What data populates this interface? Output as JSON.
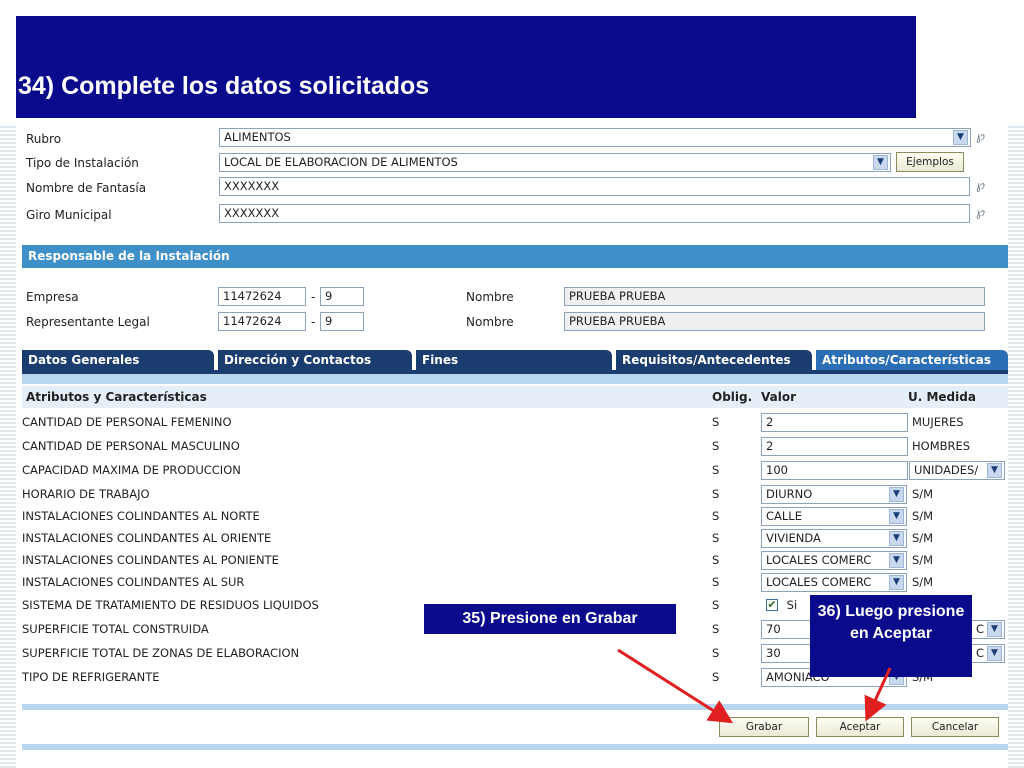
{
  "slide": {
    "title": "34) Complete los datos solicitados",
    "callout_grabar": "35) Presione en Grabar",
    "callout_aceptar": "36) Luego presione en Aceptar"
  },
  "form": {
    "rubro": {
      "label": "Rubro",
      "value": "ALIMENTOS"
    },
    "tipo": {
      "label": "Tipo de Instalación",
      "value": "LOCAL DE ELABORACION DE ALIMENTOS",
      "button": "Ejemplos"
    },
    "fantasia": {
      "label": "Nombre de Fantasía",
      "value": "XXXXXXX"
    },
    "giro": {
      "label": "Giro Municipal",
      "value": "XXXXXXX"
    },
    "help_glyph": "℘"
  },
  "responsable": {
    "section_title": "Responsable de la Instalación",
    "empresa": {
      "label": "Empresa",
      "rut": "11472624",
      "dash": "-",
      "dv": "9",
      "nombre_label": "Nombre",
      "nombre": "PRUEBA PRUEBA"
    },
    "representante": {
      "label": "Representante Legal",
      "rut": "11472624",
      "dash": "-",
      "dv": "9",
      "nombre_label": "Nombre",
      "nombre": "PRUEBA PRUEBA"
    }
  },
  "tabs": [
    {
      "label": "Datos Generales"
    },
    {
      "label": "Dirección y Contactos"
    },
    {
      "label": "Fines"
    },
    {
      "label": "Requisitos/Antecedentes"
    },
    {
      "label": "Atributos/Características"
    }
  ],
  "table": {
    "headers": {
      "name": "Atributos y Características",
      "oblig": "Oblig.",
      "valor": "Valor",
      "um": "U. Medida"
    },
    "rows": [
      {
        "name": "CANTIDAD DE PERSONAL FEMENINO",
        "oblig": "S",
        "value": "2",
        "um": "MUJERES"
      },
      {
        "name": "CANTIDAD DE PERSONAL MASCULINO",
        "oblig": "S",
        "value": "2",
        "um": "HOMBRES"
      },
      {
        "name": "CAPACIDAD MAXIMA DE PRODUCCION",
        "oblig": "S",
        "value": "100",
        "um": "UNIDADES/"
      },
      {
        "name": "HORARIO DE TRABAJO",
        "oblig": "S",
        "value": "DIURNO",
        "um": "S/M"
      },
      {
        "name": "INSTALACIONES COLINDANTES AL NORTE",
        "oblig": "S",
        "value": "CALLE",
        "um": "S/M"
      },
      {
        "name": "INSTALACIONES COLINDANTES AL ORIENTE",
        "oblig": "S",
        "value": "VIVIENDA",
        "um": "S/M"
      },
      {
        "name": "INSTALACIONES COLINDANTES AL PONIENTE",
        "oblig": "S",
        "value": "LOCALES COMERC",
        "um": "S/M"
      },
      {
        "name": "INSTALACIONES COLINDANTES AL SUR",
        "oblig": "S",
        "value": "LOCALES COMERC",
        "um": "S/M"
      },
      {
        "name": "SISTEMA DE TRATAMIENTO DE RESIDUOS LIQUIDOS",
        "oblig": "S",
        "value": "Si",
        "checkmark": "✔",
        "um": ""
      },
      {
        "name": "SUPERFICIE TOTAL CONSTRUIDA",
        "oblig": "S",
        "value": "70",
        "um": "C"
      },
      {
        "name": "SUPERFICIE TOTAL DE ZONAS DE ELABORACION",
        "oblig": "S",
        "value": "30",
        "um": "C"
      },
      {
        "name": "TIPO DE REFRIGERANTE",
        "oblig": "S",
        "value": "AMONIACO",
        "um": "S/M"
      }
    ]
  },
  "buttons": {
    "grabar": "Grabar",
    "aceptar": "Aceptar",
    "cancelar": "Cancelar"
  },
  "icons": {
    "dropdown": "chevron-down-icon",
    "help": "help-icon",
    "check": "checkmark-icon"
  },
  "colors": {
    "slide_navy": "#0a0a8c",
    "section_blue": "#3f90c9",
    "tab_navy": "#1a3c6e",
    "arrow_red": "#e02020"
  }
}
